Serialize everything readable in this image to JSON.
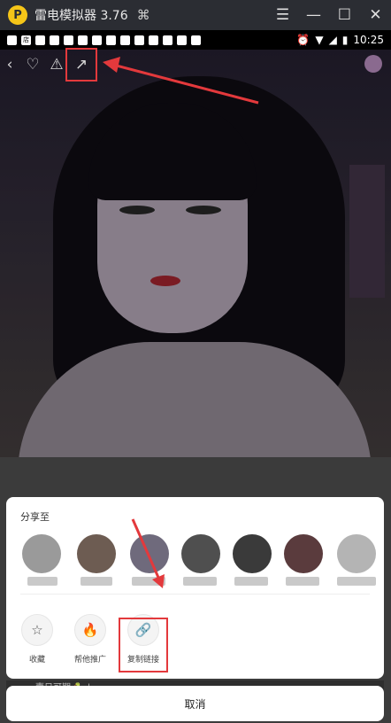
{
  "titlebar": {
    "app_name": "雷电模拟器 3.76",
    "logo_glyph": "P",
    "gamepad_icon": "gamepad-icon",
    "buttons": [
      "☰",
      "—",
      "☐",
      "✕"
    ]
  },
  "statusbar": {
    "shop_glyph": "店",
    "time": "10:25"
  },
  "sheet": {
    "title": "分享至",
    "actions": [
      {
        "label": "收藏",
        "icon": "☆"
      },
      {
        "label": "帮他推广",
        "icon": "🔥"
      },
      {
        "label": "复制链接",
        "icon": "🔗"
      }
    ],
    "cancel": "取消"
  },
  "peek": {
    "text": "壹日可期 🐍 |"
  },
  "colors": {
    "annotation_red": "#e3393c",
    "titlebar_bg": "#2b2d33"
  }
}
